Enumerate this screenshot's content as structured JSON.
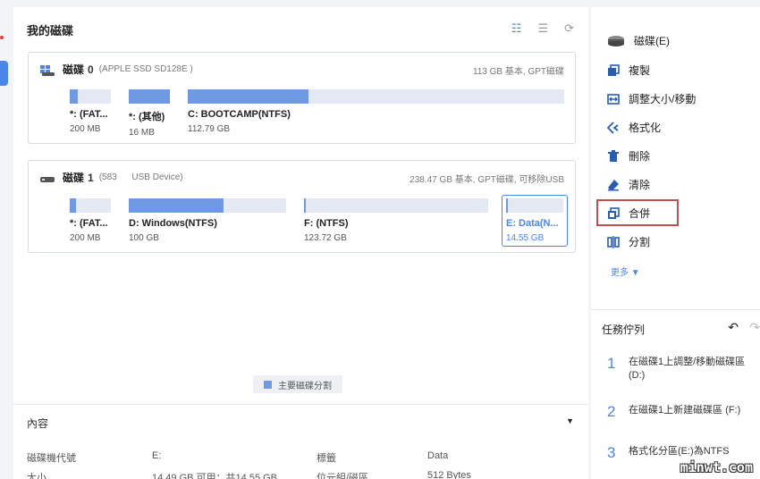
{
  "main": {
    "title": "我的磁碟"
  },
  "disks": [
    {
      "name": "磁碟",
      "number": "0",
      "model": "(APPLE SSD SD128E )",
      "info": "113 GB 基本, GPT磁碟",
      "partitions": [
        {
          "name": "*: (FAT...",
          "size": "200 MB",
          "fill": 0.2
        },
        {
          "name": "*: (其他)",
          "size": "16 MB",
          "fill": 1.0
        },
        {
          "name": "C: BOOTCAMP(NTFS)",
          "size": "112.79 GB",
          "fill": 0.32
        }
      ]
    },
    {
      "name": "磁碟",
      "number": "1",
      "model": "(583      USB Device)",
      "info": "238.47 GB 基本, GPT磁碟, 可移除USB",
      "partitions": [
        {
          "name": "*: (FAT...",
          "size": "200 MB",
          "fill": 0.15
        },
        {
          "name": "D: Windows(NTFS)",
          "size": "100 GB",
          "fill": 0.6
        },
        {
          "name": "F: (NTFS)",
          "size": "123.72 GB",
          "fill": 0.01
        },
        {
          "name": "E: Data(N...",
          "size": "14.55 GB",
          "fill": 0.02
        }
      ]
    }
  ],
  "legend": {
    "label": "主要磁碟分割",
    "color": "#6f99e3"
  },
  "content_section": {
    "title": "內容"
  },
  "properties": [
    {
      "label": "磁碟機代號",
      "value": "E:"
    },
    {
      "label": "標籤",
      "value": "Data"
    },
    {
      "label": "大小",
      "value": "14.49 GB 可用：共14.55 GB"
    },
    {
      "label": "位元組/磁區",
      "value": "512 Bytes"
    }
  ],
  "actions": {
    "header": "磁碟(E)",
    "items": [
      "複製",
      "調整大小/移動",
      "格式化",
      "刪除",
      "清除",
      "合併",
      "分割"
    ],
    "more": "更多"
  },
  "tasks": {
    "title": "任務佇列",
    "items": [
      {
        "num": "1",
        "text": "在磁碟1上調整/移動磁碟區(D:)"
      },
      {
        "num": "2",
        "text": "在磁碟1上新建磁碟區 (F:)"
      },
      {
        "num": "3",
        "text": "格式化分區(E:)為NTFS"
      }
    ]
  },
  "watermark": "minwt.com",
  "colors": {
    "accent": "#4a86e8",
    "highlight": "#c0504d",
    "bar_fill": "#6f99e3",
    "bar_empty": "#e3e8f2"
  }
}
